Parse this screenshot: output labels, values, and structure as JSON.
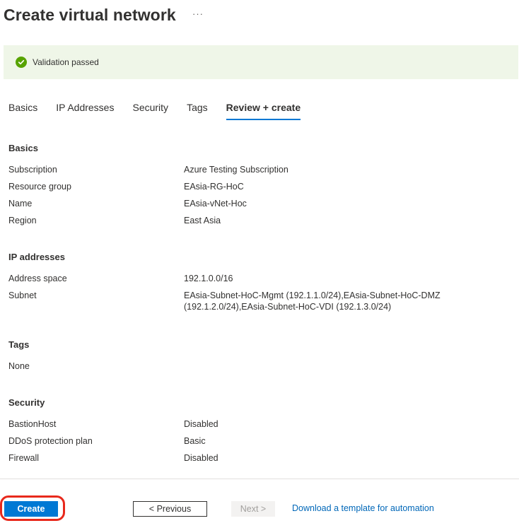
{
  "header": {
    "title": "Create virtual network",
    "more": "···"
  },
  "validation": {
    "text": "Validation passed",
    "color": "#57a300"
  },
  "tabs": [
    {
      "label": "Basics",
      "active": false
    },
    {
      "label": "IP Addresses",
      "active": false
    },
    {
      "label": "Security",
      "active": false
    },
    {
      "label": "Tags",
      "active": false
    },
    {
      "label": "Review + create",
      "active": true
    }
  ],
  "sections": {
    "basics": {
      "title": "Basics",
      "rows": [
        {
          "label": "Subscription",
          "value": "Azure Testing Subscription"
        },
        {
          "label": "Resource group",
          "value": "EAsia-RG-HoC"
        },
        {
          "label": "Name",
          "value": "EAsia-vNet-Hoc"
        },
        {
          "label": "Region",
          "value": "East Asia"
        }
      ]
    },
    "ip": {
      "title": "IP addresses",
      "rows": [
        {
          "label": "Address space",
          "value": "192.1.0.0/16"
        },
        {
          "label": "Subnet",
          "value": "EAsia-Subnet-HoC-Mgmt (192.1.1.0/24),EAsia-Subnet-HoC-DMZ (192.1.2.0/24),EAsia-Subnet-HoC-VDI (192.1.3.0/24)"
        }
      ]
    },
    "tags": {
      "title": "Tags",
      "rows": [
        {
          "label": "None",
          "value": ""
        }
      ]
    },
    "security": {
      "title": "Security",
      "rows": [
        {
          "label": "BastionHost",
          "value": "Disabled"
        },
        {
          "label": "DDoS protection plan",
          "value": "Basic"
        },
        {
          "label": "Firewall",
          "value": "Disabled"
        }
      ]
    }
  },
  "footer": {
    "create_label": "Create",
    "previous_label": "< Previous",
    "next_label": "Next >",
    "download_label": "Download a template for automation"
  },
  "colors": {
    "accent": "#0078d4",
    "highlight": "#e8291c",
    "link": "#0067b8"
  }
}
